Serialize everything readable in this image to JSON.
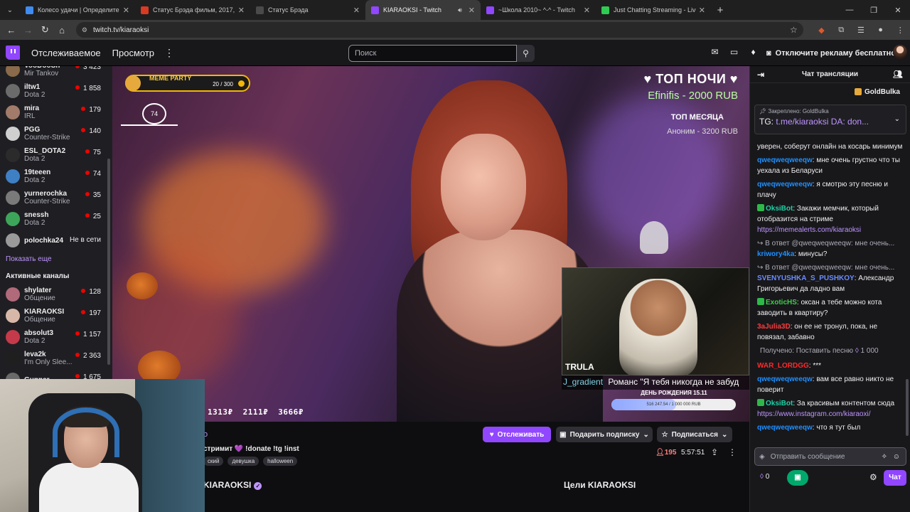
{
  "browser": {
    "tabs": [
      {
        "title": "Колесо удачи | Определите п",
        "fav": "#3f8bf0",
        "active": false,
        "audio": false
      },
      {
        "title": "Статус Брэда фильм, 2017, дат",
        "fav": "#d83a22",
        "active": false,
        "audio": false
      },
      {
        "title": "Статус Брэда",
        "fav": "#4a4a4a",
        "active": false,
        "audio": false
      },
      {
        "title": "KIARAOKSI - Twitch",
        "fav": "#9147ff",
        "active": true,
        "audio": true
      },
      {
        "title": "~Школа 2010~ ^-^ - Twitch",
        "fav": "#9147ff",
        "active": false,
        "audio": false
      },
      {
        "title": "Just Chatting Streaming - Live",
        "fav": "#2fcc52",
        "active": false,
        "audio": false
      }
    ],
    "url": "twitch.tv/kiaraoksi"
  },
  "twitch_nav": {
    "following": "Отслеживаемое",
    "browse": "Просмотр",
    "search_placeholder": "Поиск",
    "ad_free": "Отключите рекламу бесплатно"
  },
  "sidebar": {
    "followed": [
      {
        "name": "VooDooSh",
        "game": "Mir Tankov",
        "viewers": "3 423",
        "color": "#8a6a4a"
      },
      {
        "name": "iltw1",
        "game": "Dota 2",
        "viewers": "1 858",
        "color": "#6b6b6b"
      },
      {
        "name": "mira",
        "game": "IRL",
        "viewers": "179",
        "color": "#a27b6a"
      },
      {
        "name": "PGG",
        "game": "Counter-Strike",
        "viewers": "140",
        "color": "#cfcfcf"
      },
      {
        "name": "ESL_DOTA2",
        "game": "Dota 2",
        "viewers": "75",
        "color": "#2b2b2b"
      },
      {
        "name": "19teeen",
        "game": "Dota 2",
        "viewers": "74",
        "color": "#3f7fc4"
      },
      {
        "name": "yurnerochka",
        "game": "Counter-Strike",
        "viewers": "35",
        "color": "#7a7a7a"
      },
      {
        "name": "snessh",
        "game": "Dota 2",
        "viewers": "25",
        "color": "#3da55a"
      }
    ],
    "offline": {
      "name": "polochka24",
      "status": "Не в сети",
      "color": "#9a9a9a"
    },
    "show_more": "Показать еще",
    "active_title": "Активные каналы",
    "active": [
      {
        "name": "shylater",
        "game": "Общение",
        "viewers": "128",
        "color": "#b06a7a"
      },
      {
        "name": "KIARAOKSI",
        "game": "Общение",
        "viewers": "197",
        "color": "#d7b8a8"
      },
      {
        "name": "absolut3",
        "game": "Dota 2",
        "viewers": "1 157",
        "color": "#c43a4a"
      },
      {
        "name": "leva2k",
        "game": "I'm Only Slee...",
        "viewers": "2 363",
        "color": "#1f1f1f"
      },
      {
        "name": "Gunnar",
        "game": "",
        "viewers": "1 675",
        "color": "#6a6a6a"
      }
    ]
  },
  "stream": {
    "meme_party": "MEME PARTY",
    "meme_progress": "20 / 300",
    "heart_rate": "74",
    "top_night": "ТОП НОЧИ",
    "top_night_value": "Efinifis - 2000 RUB",
    "top_month": "ТОП МЕСЯЦА",
    "top_month_value": "Аноним - 3200 RUB",
    "donations": [
      "1313₽",
      "2111₽",
      "3666₽"
    ],
    "pip_brand": "TRULA",
    "pip_user": "J_gradient",
    "pip_text": "Романс \"Я тебя никогда не забуд",
    "birthday": "ДЕНЬ РОЖДЕНИЯ 15.11",
    "birthday_goal": "516 247.54 / 1 000 000 RUB",
    "birthday_fraction": 0.52
  },
  "channel": {
    "name_partial": "o",
    "title": "стримит 💜 !donate !tg !inst",
    "tags": [
      "ский",
      "девушка",
      "halloween"
    ],
    "follow": "Отслеживать",
    "gift_sub": "Подарить подписку",
    "subscribe": "Подписаться",
    "viewers": "195",
    "uptime": "5:57:51",
    "about_name": "KIARAOKSI",
    "goals": "Цели KIARAOKSI"
  },
  "chat": {
    "title": "Чат трансляции",
    "top_gifter": "GoldBulka",
    "pinned_by": "Закреплено: GoldBulka",
    "pinned_prefix": "TG: ",
    "pinned_link": "t.me/kiaraoksi",
    "pinned_suffix": " DA: don...",
    "messages": [
      {
        "type": "cont",
        "text": "уверен, соберут онлайн на косарь минимум"
      },
      {
        "type": "msg",
        "user": "qweqweqweeqw",
        "color": "#1e90ff",
        "text": "мне очень грустно что ты уехала из Беларуси"
      },
      {
        "type": "msg",
        "user": "qweqweqweeqw",
        "color": "#1e90ff",
        "text": "я смотрю эту песню и плачу"
      },
      {
        "type": "msg",
        "user": "OksiBot",
        "color": "#1fd1a5",
        "text": "Закажи мемчик, который отобразится на стриме ",
        "link": "https://memealerts.com/kiaraoksi"
      },
      {
        "type": "reply",
        "reply": "В ответ @qweqweqweeqw: мне очень...",
        "user": "kriwory4ka",
        "color": "#1e90ff",
        "text": "минусы?"
      },
      {
        "type": "reply",
        "reply": "В ответ @qweqweqweeqw: мне очень...",
        "user": "SVENYUSHKA_S_PUSHKOY",
        "color": "#6b8cff",
        "text": "Александр Григорьевич да ладно вам"
      },
      {
        "type": "msg",
        "user": "ExoticHS",
        "color": "#3fcf4a",
        "text": "оксан а тебе можно кота заводить в квартиру?"
      },
      {
        "type": "msg",
        "user": "3aJulia3D",
        "color": "#ff3b3b",
        "text": "он ее не тронул, пока, не повязал, забавно"
      },
      {
        "type": "redeem",
        "text": "Получено: Поставить песню",
        "points": "1 000"
      },
      {
        "type": "msg",
        "user": "WAR_LORDGG",
        "color": "#ff2a2a",
        "text": "***"
      },
      {
        "type": "msg",
        "user": "qweqweqweeqw",
        "color": "#1e90ff",
        "text": "вам все равно никто не поверит"
      },
      {
        "type": "msg",
        "user": "OksiBot",
        "color": "#1fd1a5",
        "text": "За красивым контентом сюда ",
        "link": "https://www.instagram.com/kiaraoxi/"
      },
      {
        "type": "msg",
        "user": "qweqweqweeqw",
        "color": "#1e90ff",
        "text": "что я тут был"
      }
    ],
    "input_placeholder": "Отправить сообщение",
    "points": "0",
    "send": "Чат"
  }
}
